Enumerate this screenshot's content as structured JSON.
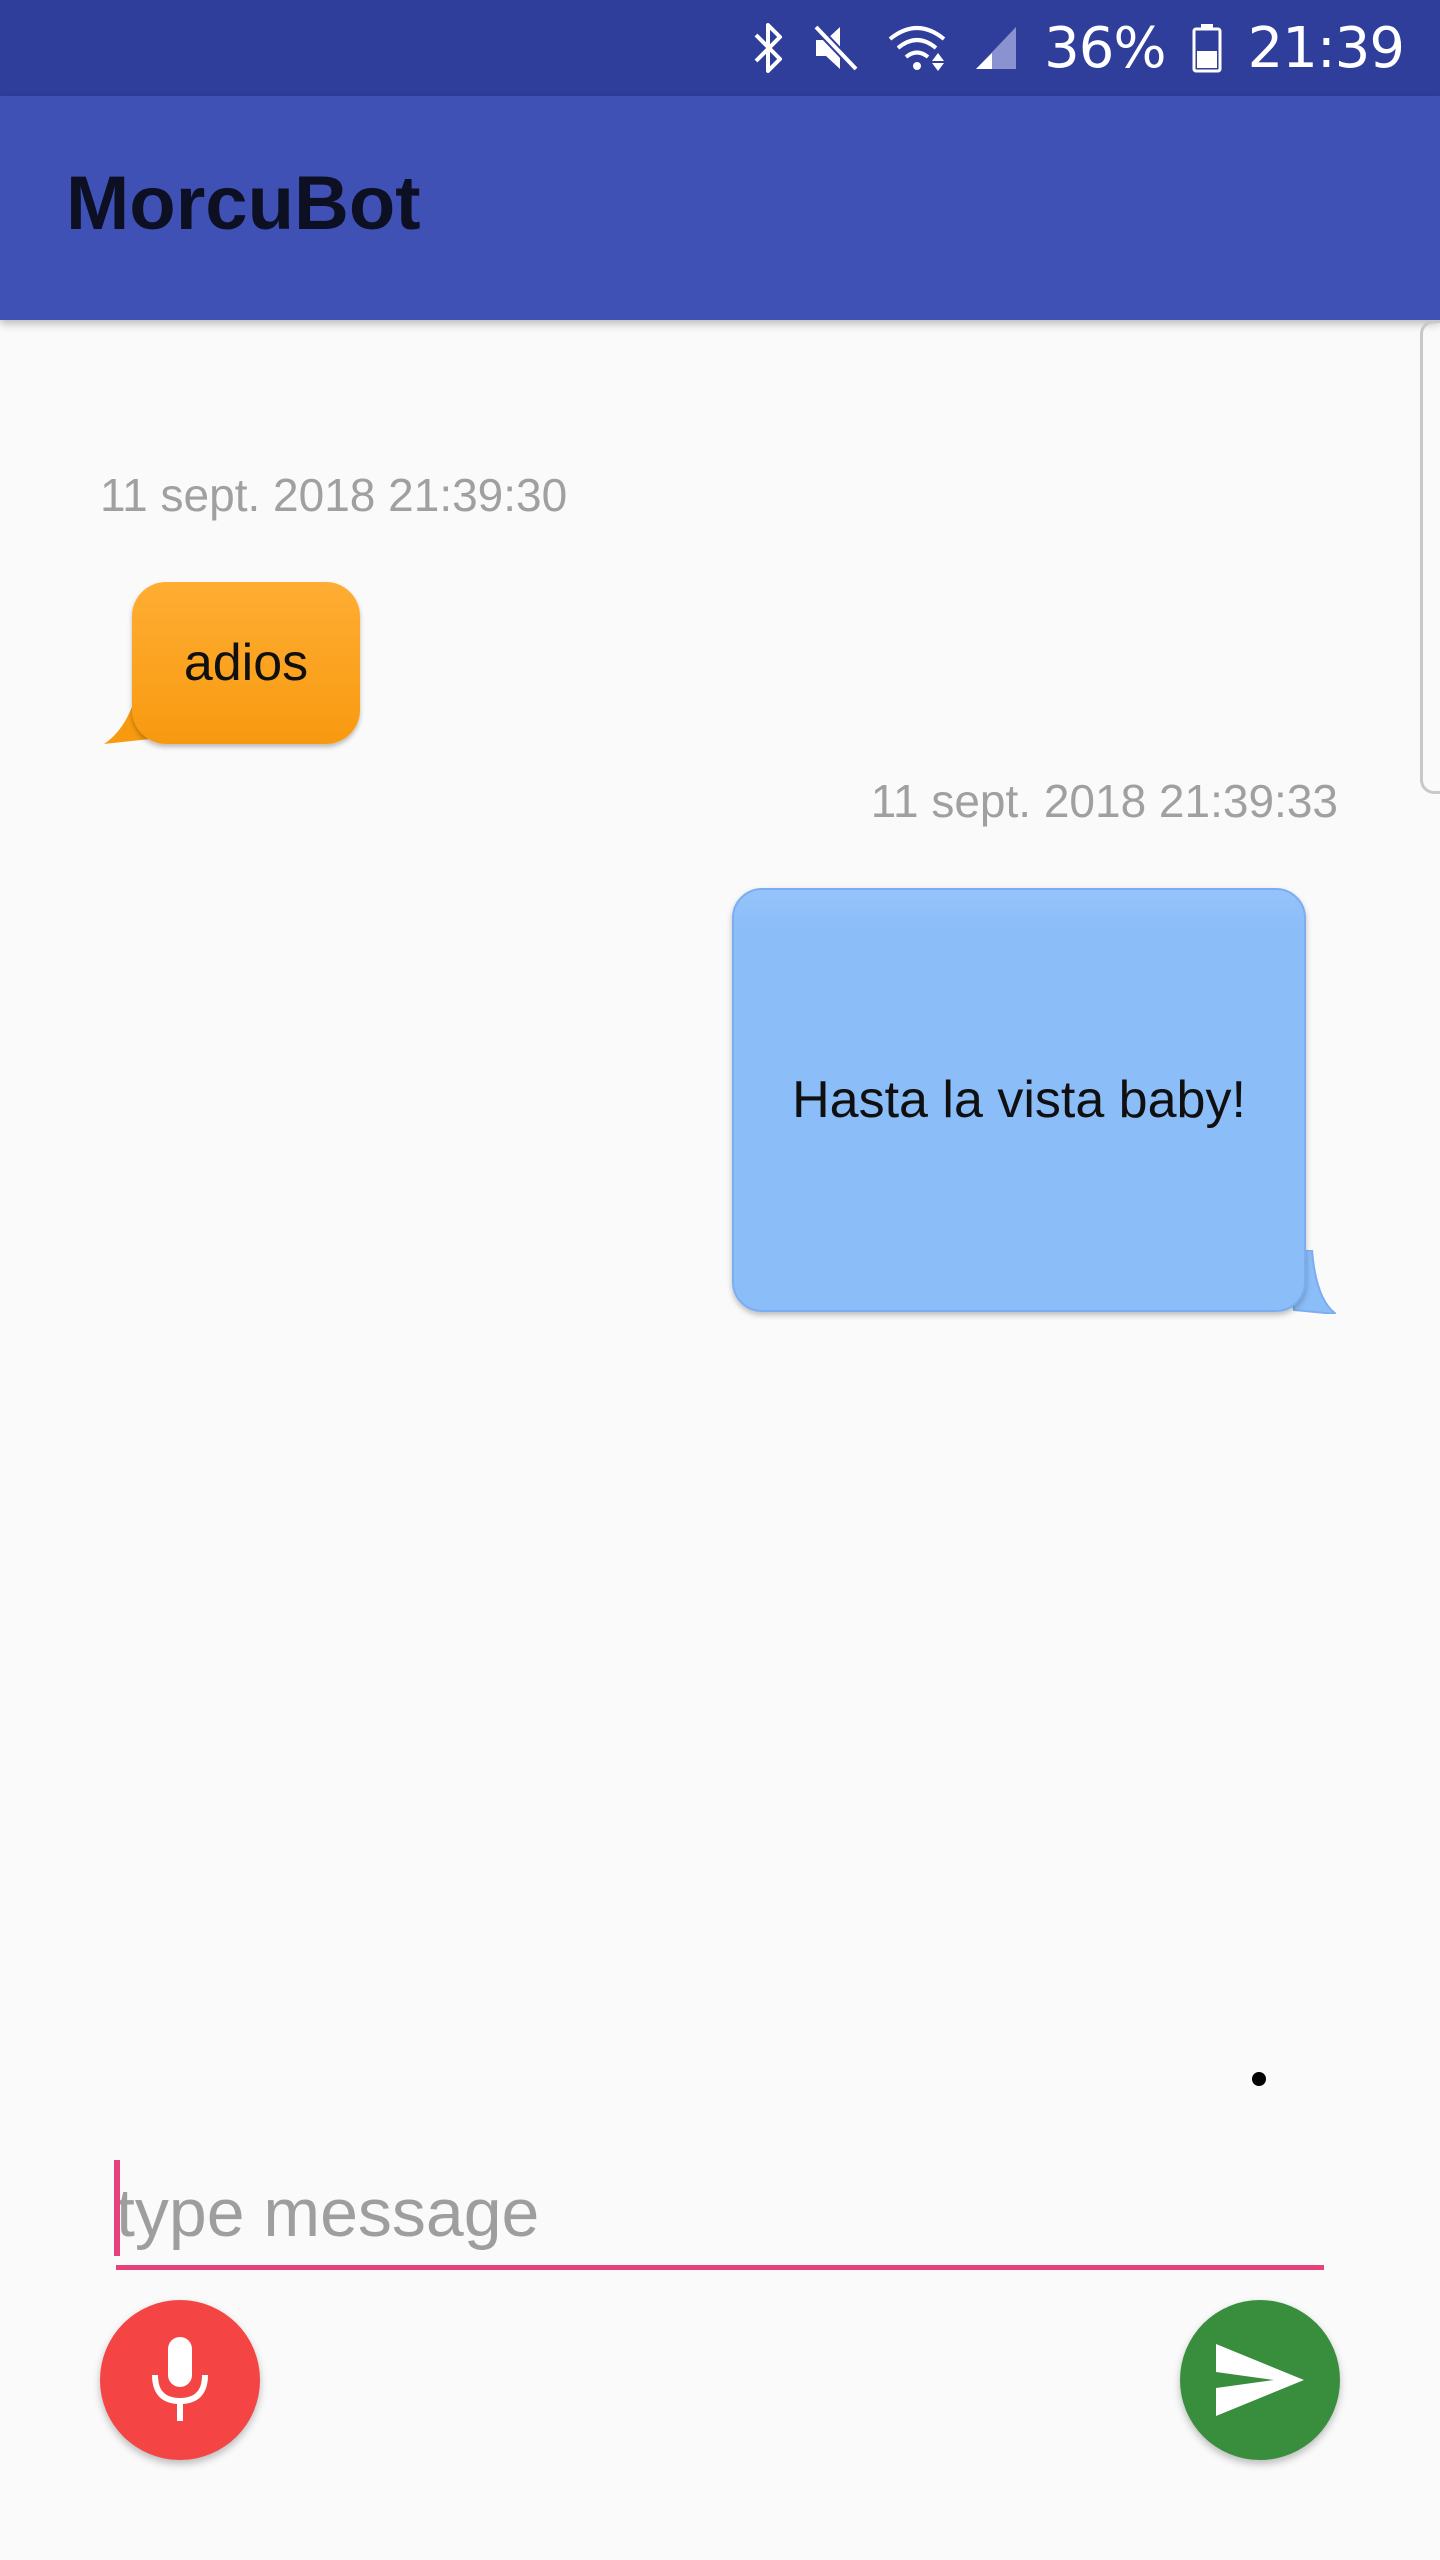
{
  "status_bar": {
    "battery_percent": "36%",
    "time": "21:39",
    "icons": [
      "bluetooth-icon",
      "mute-icon",
      "wifi-icon",
      "signal-icon",
      "battery-icon"
    ]
  },
  "app_bar": {
    "title": "MorcuBot"
  },
  "messages": [
    {
      "sender": "bot",
      "timestamp": "11 sept. 2018 21:39:30",
      "text": "adios",
      "color": "#ffa21f"
    },
    {
      "sender": "user",
      "timestamp": "11 sept. 2018 21:39:33",
      "text": "Hasta la vista baby!",
      "color": "#8bbdf9"
    }
  ],
  "composer": {
    "placeholder": "type message",
    "mic_icon": "microphone-icon",
    "send_icon": "send-icon",
    "mic_color": "#f44444",
    "send_color": "#388e3c",
    "accent": "#e6407d"
  },
  "colors": {
    "status_bar": "#2f3d9b",
    "app_bar": "#3f51b5",
    "background": "#fafafa"
  }
}
